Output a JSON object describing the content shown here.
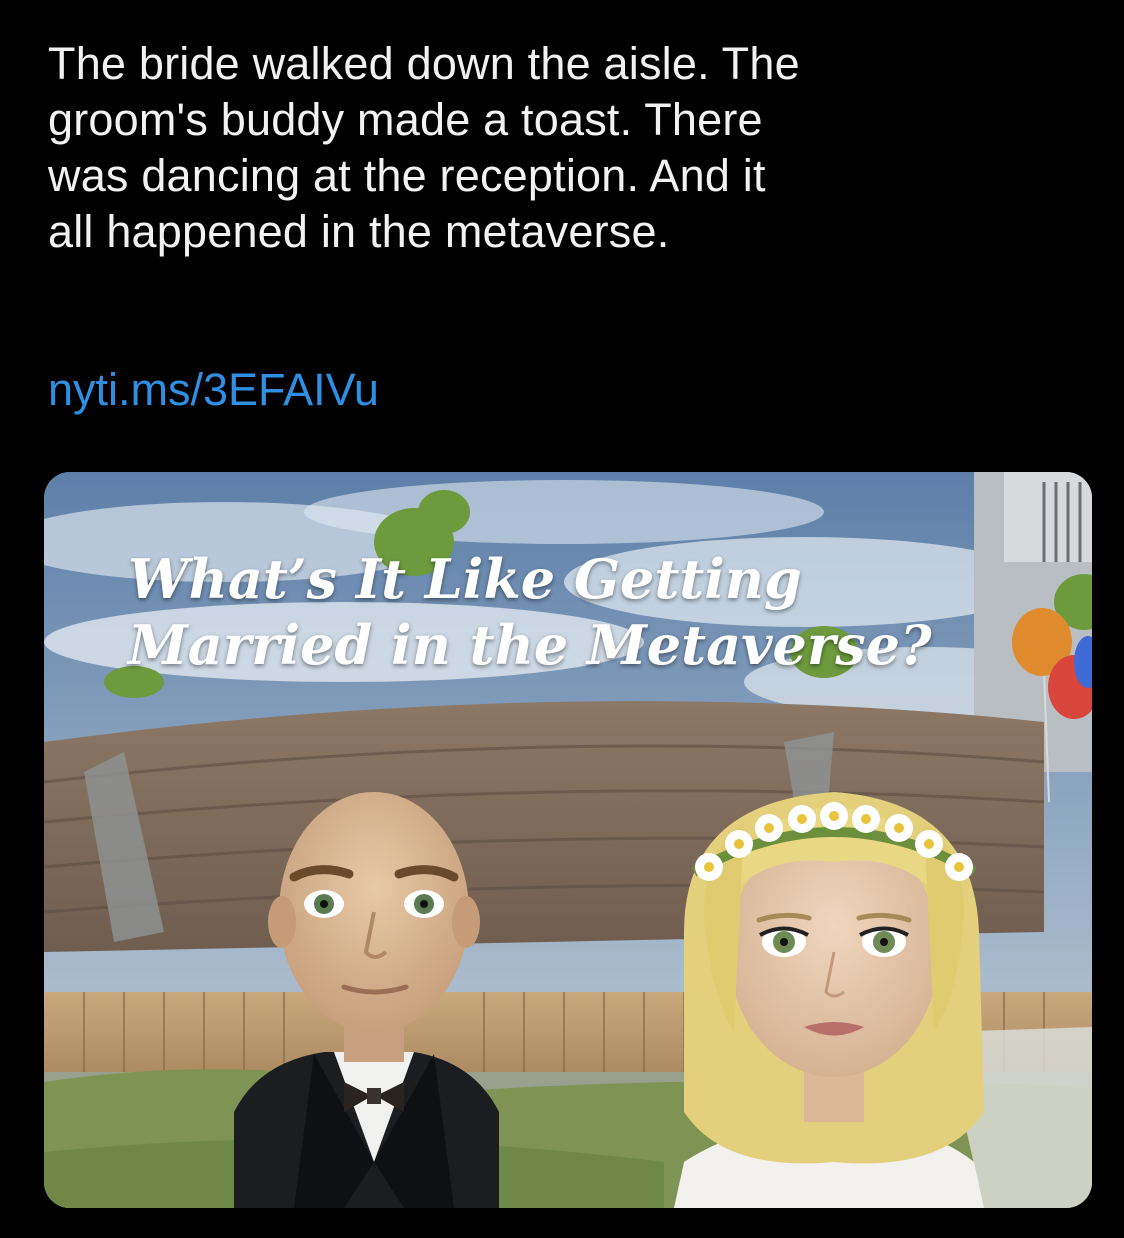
{
  "tweet": {
    "text_lines": [
      "The bride walked down the aisle. The",
      "groom's buddy made a toast. There",
      "was dancing at the reception. And it",
      "all happened in the metaverse."
    ],
    "link": "nyti.ms/3EFAIVu"
  },
  "card": {
    "headline_lines": [
      "What’s It Like Getting",
      "Married in the Metaverse?"
    ],
    "image_subject": "avatar-couple-wedding-scene"
  },
  "colors": {
    "background": "#000000",
    "text": "#f2f2f2",
    "link": "#2f8fe3",
    "sky": "#6f8fb4",
    "headline": "#ffffff"
  }
}
